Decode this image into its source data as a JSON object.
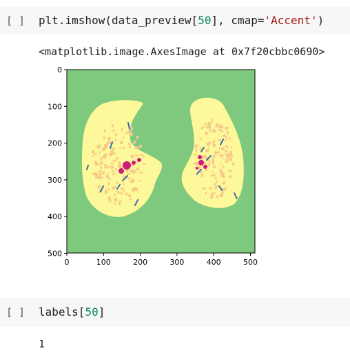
{
  "cell1": {
    "prompt": "[ ]",
    "code_pre": "plt.imshow(data_preview[",
    "code_num": "50",
    "code_mid": "], cmap=",
    "code_str": "'Accent'",
    "code_post": ")",
    "output_repr": "<matplotlib.image.AxesImage at 0x7f20cbbc0690>"
  },
  "image_plot": {
    "y_ticks": [
      "0",
      "100",
      "200",
      "300",
      "400",
      "500"
    ],
    "x_ticks": [
      "0",
      "100",
      "200",
      "300",
      "400",
      "500"
    ],
    "colors": {
      "background": "#7fc97f",
      "lung": "#fdf89a",
      "tissue": "#f7c98a",
      "vessel": "#386cb0",
      "dense": "#d11a7a",
      "frame": "#000000"
    }
  },
  "cell2": {
    "prompt": "[ ]",
    "code_pre": "labels[",
    "code_num": "50",
    "code_post": "]",
    "output": "1"
  }
}
